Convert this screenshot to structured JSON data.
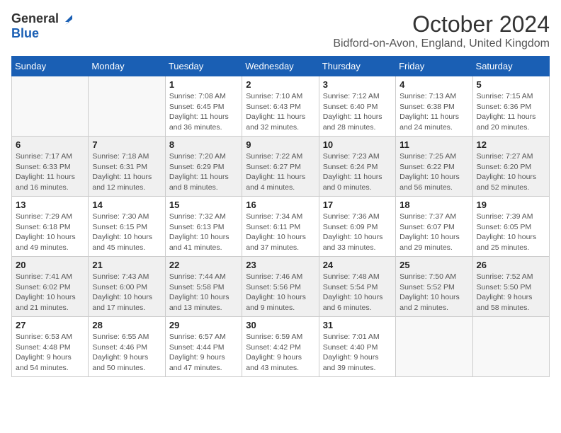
{
  "logo": {
    "general": "General",
    "blue": "Blue"
  },
  "title": {
    "month_year": "October 2024",
    "location": "Bidford-on-Avon, England, United Kingdom"
  },
  "headers": [
    "Sunday",
    "Monday",
    "Tuesday",
    "Wednesday",
    "Thursday",
    "Friday",
    "Saturday"
  ],
  "weeks": [
    [
      {
        "day": "",
        "sunrise": "",
        "sunset": "",
        "daylight": "",
        "empty": true
      },
      {
        "day": "",
        "sunrise": "",
        "sunset": "",
        "daylight": "",
        "empty": true
      },
      {
        "day": "1",
        "sunrise": "Sunrise: 7:08 AM",
        "sunset": "Sunset: 6:45 PM",
        "daylight": "Daylight: 11 hours and 36 minutes."
      },
      {
        "day": "2",
        "sunrise": "Sunrise: 7:10 AM",
        "sunset": "Sunset: 6:43 PM",
        "daylight": "Daylight: 11 hours and 32 minutes."
      },
      {
        "day": "3",
        "sunrise": "Sunrise: 7:12 AM",
        "sunset": "Sunset: 6:40 PM",
        "daylight": "Daylight: 11 hours and 28 minutes."
      },
      {
        "day": "4",
        "sunrise": "Sunrise: 7:13 AM",
        "sunset": "Sunset: 6:38 PM",
        "daylight": "Daylight: 11 hours and 24 minutes."
      },
      {
        "day": "5",
        "sunrise": "Sunrise: 7:15 AM",
        "sunset": "Sunset: 6:36 PM",
        "daylight": "Daylight: 11 hours and 20 minutes."
      }
    ],
    [
      {
        "day": "6",
        "sunrise": "Sunrise: 7:17 AM",
        "sunset": "Sunset: 6:33 PM",
        "daylight": "Daylight: 11 hours and 16 minutes."
      },
      {
        "day": "7",
        "sunrise": "Sunrise: 7:18 AM",
        "sunset": "Sunset: 6:31 PM",
        "daylight": "Daylight: 11 hours and 12 minutes."
      },
      {
        "day": "8",
        "sunrise": "Sunrise: 7:20 AM",
        "sunset": "Sunset: 6:29 PM",
        "daylight": "Daylight: 11 hours and 8 minutes."
      },
      {
        "day": "9",
        "sunrise": "Sunrise: 7:22 AM",
        "sunset": "Sunset: 6:27 PM",
        "daylight": "Daylight: 11 hours and 4 minutes."
      },
      {
        "day": "10",
        "sunrise": "Sunrise: 7:23 AM",
        "sunset": "Sunset: 6:24 PM",
        "daylight": "Daylight: 11 hours and 0 minutes."
      },
      {
        "day": "11",
        "sunrise": "Sunrise: 7:25 AM",
        "sunset": "Sunset: 6:22 PM",
        "daylight": "Daylight: 10 hours and 56 minutes."
      },
      {
        "day": "12",
        "sunrise": "Sunrise: 7:27 AM",
        "sunset": "Sunset: 6:20 PM",
        "daylight": "Daylight: 10 hours and 52 minutes."
      }
    ],
    [
      {
        "day": "13",
        "sunrise": "Sunrise: 7:29 AM",
        "sunset": "Sunset: 6:18 PM",
        "daylight": "Daylight: 10 hours and 49 minutes."
      },
      {
        "day": "14",
        "sunrise": "Sunrise: 7:30 AM",
        "sunset": "Sunset: 6:15 PM",
        "daylight": "Daylight: 10 hours and 45 minutes."
      },
      {
        "day": "15",
        "sunrise": "Sunrise: 7:32 AM",
        "sunset": "Sunset: 6:13 PM",
        "daylight": "Daylight: 10 hours and 41 minutes."
      },
      {
        "day": "16",
        "sunrise": "Sunrise: 7:34 AM",
        "sunset": "Sunset: 6:11 PM",
        "daylight": "Daylight: 10 hours and 37 minutes."
      },
      {
        "day": "17",
        "sunrise": "Sunrise: 7:36 AM",
        "sunset": "Sunset: 6:09 PM",
        "daylight": "Daylight: 10 hours and 33 minutes."
      },
      {
        "day": "18",
        "sunrise": "Sunrise: 7:37 AM",
        "sunset": "Sunset: 6:07 PM",
        "daylight": "Daylight: 10 hours and 29 minutes."
      },
      {
        "day": "19",
        "sunrise": "Sunrise: 7:39 AM",
        "sunset": "Sunset: 6:05 PM",
        "daylight": "Daylight: 10 hours and 25 minutes."
      }
    ],
    [
      {
        "day": "20",
        "sunrise": "Sunrise: 7:41 AM",
        "sunset": "Sunset: 6:02 PM",
        "daylight": "Daylight: 10 hours and 21 minutes."
      },
      {
        "day": "21",
        "sunrise": "Sunrise: 7:43 AM",
        "sunset": "Sunset: 6:00 PM",
        "daylight": "Daylight: 10 hours and 17 minutes."
      },
      {
        "day": "22",
        "sunrise": "Sunrise: 7:44 AM",
        "sunset": "Sunset: 5:58 PM",
        "daylight": "Daylight: 10 hours and 13 minutes."
      },
      {
        "day": "23",
        "sunrise": "Sunrise: 7:46 AM",
        "sunset": "Sunset: 5:56 PM",
        "daylight": "Daylight: 10 hours and 9 minutes."
      },
      {
        "day": "24",
        "sunrise": "Sunrise: 7:48 AM",
        "sunset": "Sunset: 5:54 PM",
        "daylight": "Daylight: 10 hours and 6 minutes."
      },
      {
        "day": "25",
        "sunrise": "Sunrise: 7:50 AM",
        "sunset": "Sunset: 5:52 PM",
        "daylight": "Daylight: 10 hours and 2 minutes."
      },
      {
        "day": "26",
        "sunrise": "Sunrise: 7:52 AM",
        "sunset": "Sunset: 5:50 PM",
        "daylight": "Daylight: 9 hours and 58 minutes."
      }
    ],
    [
      {
        "day": "27",
        "sunrise": "Sunrise: 6:53 AM",
        "sunset": "Sunset: 4:48 PM",
        "daylight": "Daylight: 9 hours and 54 minutes."
      },
      {
        "day": "28",
        "sunrise": "Sunrise: 6:55 AM",
        "sunset": "Sunset: 4:46 PM",
        "daylight": "Daylight: 9 hours and 50 minutes."
      },
      {
        "day": "29",
        "sunrise": "Sunrise: 6:57 AM",
        "sunset": "Sunset: 4:44 PM",
        "daylight": "Daylight: 9 hours and 47 minutes."
      },
      {
        "day": "30",
        "sunrise": "Sunrise: 6:59 AM",
        "sunset": "Sunset: 4:42 PM",
        "daylight": "Daylight: 9 hours and 43 minutes."
      },
      {
        "day": "31",
        "sunrise": "Sunrise: 7:01 AM",
        "sunset": "Sunset: 4:40 PM",
        "daylight": "Daylight: 9 hours and 39 minutes."
      },
      {
        "day": "",
        "sunrise": "",
        "sunset": "",
        "daylight": "",
        "empty": true
      },
      {
        "day": "",
        "sunrise": "",
        "sunset": "",
        "daylight": "",
        "empty": true
      }
    ]
  ]
}
